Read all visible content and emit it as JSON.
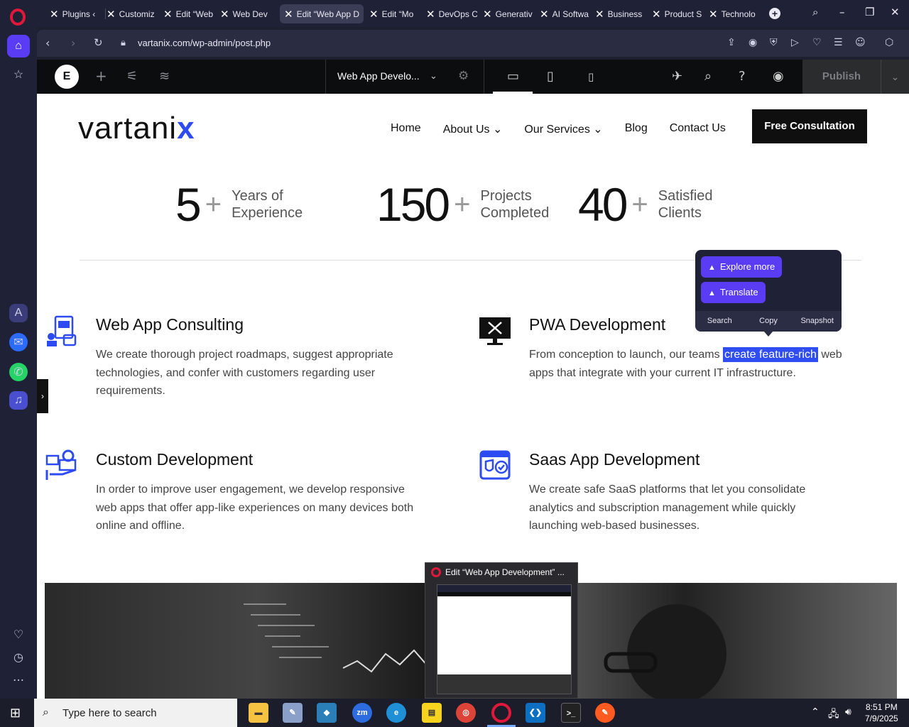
{
  "browser": {
    "tabs": [
      {
        "label": "Plugins ‹"
      },
      {
        "label": "Customiz"
      },
      {
        "label": "Edit “Web"
      },
      {
        "label": "Web Dev"
      },
      {
        "label": "Edit “Web App D"
      },
      {
        "label": "Edit “Mo"
      },
      {
        "label": "DevOps C"
      },
      {
        "label": "Generativ"
      },
      {
        "label": "AI Softwa"
      },
      {
        "label": "Business"
      },
      {
        "label": "Product S"
      },
      {
        "label": "Technolo"
      }
    ],
    "url": "vartanix.com/wp-admin/post.php"
  },
  "editor": {
    "page_title": "Web App Develo...",
    "publish_label": "Publish"
  },
  "site": {
    "logo_text": "vartani",
    "logo_x": "x",
    "nav": [
      "Home",
      "About Us ⌄",
      "Our Services ⌄",
      "Blog",
      "Contact Us"
    ],
    "cta": "Free Consultation",
    "stats": [
      {
        "num": "5",
        "l1": "Years of",
        "l2": "Experience"
      },
      {
        "num": "150",
        "l1": "Projects",
        "l2": "Completed"
      },
      {
        "num": "40",
        "l1": "Satisfied",
        "l2": "Clients"
      }
    ],
    "services": [
      {
        "title": "Web App Consulting",
        "text": "We create thorough project roadmaps, suggest appropriate technologies, and confer with customers regarding user requirements."
      },
      {
        "title": "PWA Development",
        "text_a": "From conception to launch, our teams ",
        "text_hl": "create feature-rich",
        "text_b": " web apps that integrate with your current IT infrastructure."
      },
      {
        "title": "Custom Development",
        "text": "In order to improve user engagement, we develop responsive web apps that offer app-like experiences on many devices both online and offline."
      },
      {
        "title": "Saas App Development",
        "text": "We create safe SaaS platforms that let you consolidate analytics and subscription management while quickly launching web-based businesses."
      }
    ]
  },
  "popup": {
    "explore": "Explore more",
    "translate": "Translate",
    "search": "Search",
    "copy": "Copy",
    "snapshot": "Snapshot"
  },
  "thumbnail": {
    "title": "Edit “Web App Development” ..."
  },
  "taskbar": {
    "search_placeholder": "Type here to search",
    "time": "8:51 PM",
    "date": "7/9/2025"
  },
  "colors": {
    "accent": "#5b3cf5",
    "highlight": "#2f4df0",
    "brand_blue": "#2d4bf0"
  }
}
